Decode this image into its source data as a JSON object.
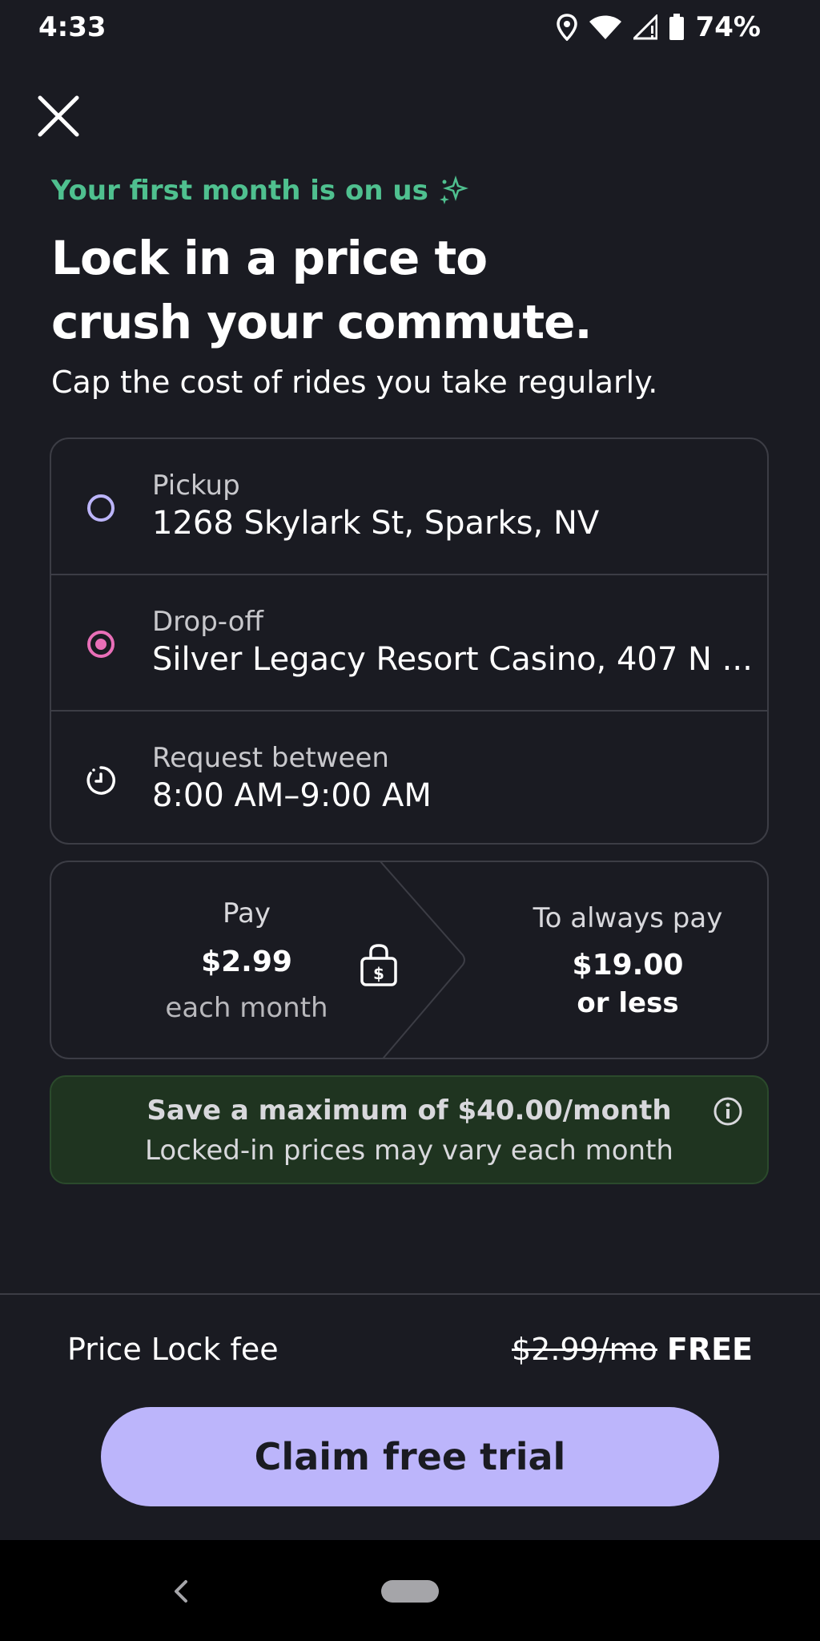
{
  "status_bar": {
    "time": "4:33",
    "battery": "74%"
  },
  "header": {
    "tagline": "Your first month is on us",
    "headline_line1": "Lock in a price to",
    "headline_line2": "crush your commute.",
    "subtitle": "Cap the cost of rides you take regularly."
  },
  "trip": {
    "pickup_label": "Pickup",
    "pickup_value": "1268 Skylark St, Sparks, NV",
    "dropoff_label": "Drop-off",
    "dropoff_value": "Silver Legacy Resort Casino, 407 N ...",
    "time_label": "Request between",
    "time_value": "8:00 AM–9:00 AM"
  },
  "pay": {
    "label": "Pay",
    "amount": "$2.99",
    "period": "each month",
    "always_label": "To always pay",
    "always_amount": "$19.00",
    "always_suffix": "or less"
  },
  "savings": {
    "title": "Save a maximum of $40.00/month",
    "subtitle": "Locked-in prices may vary each month"
  },
  "footer": {
    "fee_label": "Price Lock fee",
    "fee_old": "$2.99/mo",
    "fee_new": "FREE",
    "claim_label": "Claim free trial"
  },
  "colors": {
    "background": "#1a1b22",
    "accent_green": "#4fc08f",
    "button": "#bcb5fb",
    "pickup_ring": "#bcb5fb",
    "dropoff_ring": "#e96fb8",
    "savings_bg": "#1f3420"
  },
  "icons": [
    "location-icon",
    "wifi-icon",
    "signal-icon",
    "battery-icon",
    "close-icon",
    "sparkle-icon",
    "pickup-dot-icon",
    "dropoff-dot-icon",
    "clock-icon",
    "price-lock-icon",
    "info-icon",
    "back-icon"
  ]
}
